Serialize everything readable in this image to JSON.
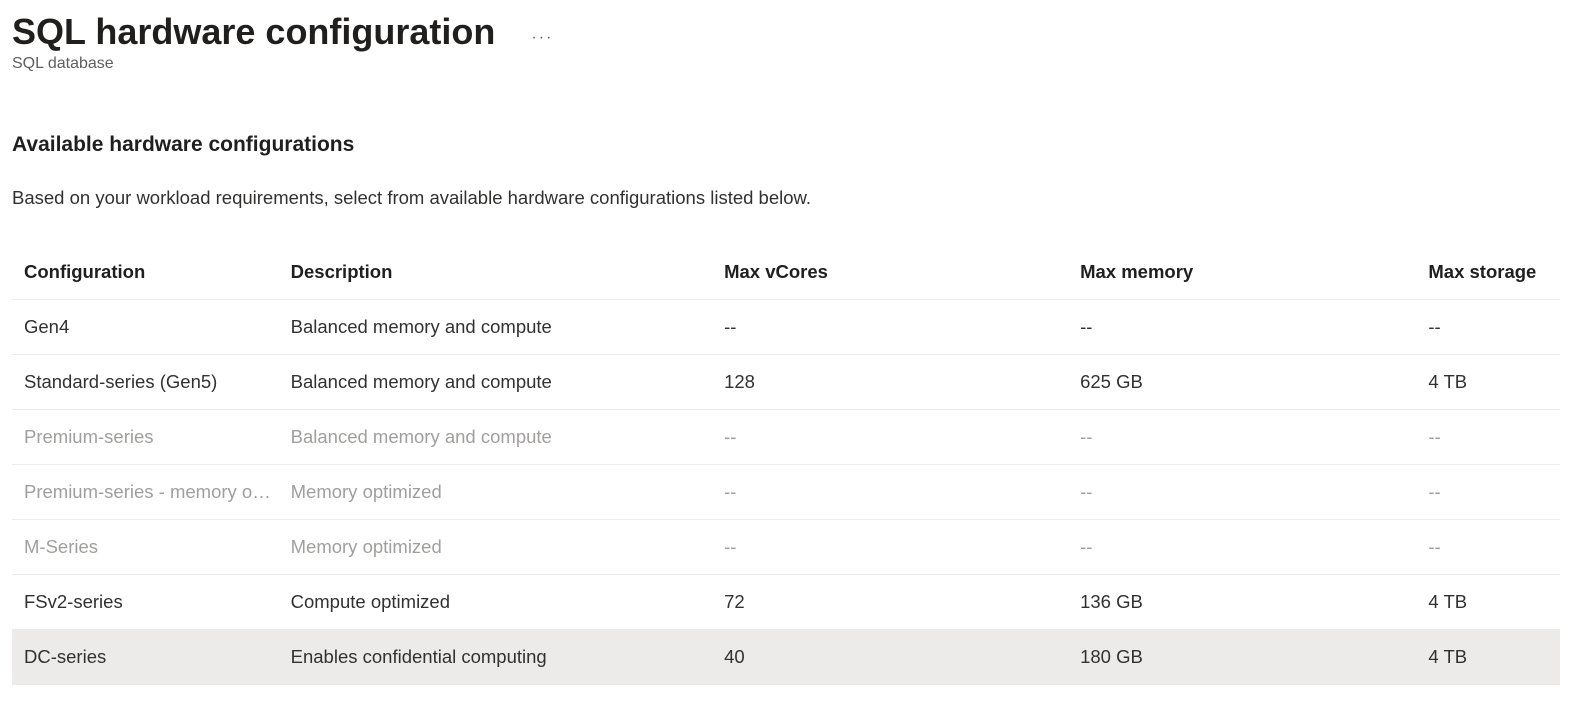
{
  "header": {
    "title": "SQL hardware configuration",
    "subtitle": "SQL database",
    "ellipsis": "···"
  },
  "section": {
    "heading": "Available hardware configurations",
    "description": "Based on your workload requirements, select from available hardware configurations listed below."
  },
  "table": {
    "headers": {
      "configuration": "Configuration",
      "description": "Description",
      "max_vcores": "Max vCores",
      "max_memory": "Max memory",
      "max_storage": "Max storage"
    },
    "rows": [
      {
        "configuration": "Gen4",
        "description": "Balanced memory and compute",
        "max_vcores": "--",
        "max_memory": "--",
        "max_storage": "--",
        "disabled": false,
        "selected": false
      },
      {
        "configuration": "Standard-series (Gen5)",
        "description": "Balanced memory and compute",
        "max_vcores": "128",
        "max_memory": "625 GB",
        "max_storage": "4 TB",
        "disabled": false,
        "selected": false
      },
      {
        "configuration": "Premium-series",
        "description": "Balanced memory and compute",
        "max_vcores": "--",
        "max_memory": "--",
        "max_storage": "--",
        "disabled": true,
        "selected": false
      },
      {
        "configuration": "Premium-series - memory optimized",
        "description": "Memory optimized",
        "max_vcores": "--",
        "max_memory": "--",
        "max_storage": "--",
        "disabled": true,
        "selected": false
      },
      {
        "configuration": "M-Series",
        "description": "Memory optimized",
        "max_vcores": "--",
        "max_memory": "--",
        "max_storage": "--",
        "disabled": true,
        "selected": false
      },
      {
        "configuration": "FSv2-series",
        "description": "Compute optimized",
        "max_vcores": "72",
        "max_memory": "136 GB",
        "max_storage": "4 TB",
        "disabled": false,
        "selected": false
      },
      {
        "configuration": "DC-series",
        "description": "Enables confidential computing",
        "max_vcores": "40",
        "max_memory": "180 GB",
        "max_storage": "4 TB",
        "disabled": false,
        "selected": true
      }
    ]
  }
}
